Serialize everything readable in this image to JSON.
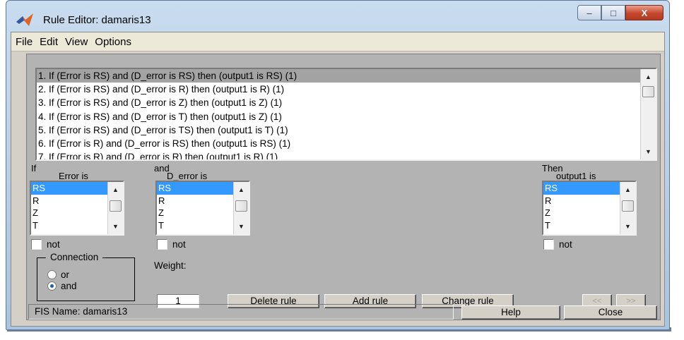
{
  "window": {
    "title": "Rule Editor: damaris13",
    "controls": [
      "–",
      "□",
      "X"
    ]
  },
  "menu": [
    "File",
    "Edit",
    "View",
    "Options"
  ],
  "rules": [
    "1. If (Error is RS) and (D_error is RS) then (output1 is RS) (1)",
    "2. If (Error is RS) and (D_error is R) then (output1 is R) (1)",
    "3. If (Error is RS) and (D_error is Z) then (output1 is Z) (1)",
    "4. If (Error is RS) and (D_error is T) then (output1 is Z) (1)",
    "5. If (Error is RS) and (D_error is TS) then (output1 is T) (1)",
    "6. If (Error is R) and (D_error is RS) then (output1 is RS) (1)",
    "7. If (Error is R) and (D_error is R) then (output1 is R) (1)"
  ],
  "inputs": {
    "error": {
      "prefix": "If",
      "label": "Error is",
      "items": [
        "RS",
        "R",
        "Z",
        "T"
      ],
      "selected": "RS",
      "not_label": "not"
    },
    "d_error": {
      "prefix": "and",
      "label": "D_error is",
      "items": [
        "RS",
        "R",
        "Z",
        "T"
      ],
      "selected": "RS",
      "not_label": "not"
    },
    "output": {
      "prefix": "Then",
      "label": "output1 is",
      "items": [
        "RS",
        "R",
        "Z",
        "T"
      ],
      "selected": "RS",
      "not_label": "not"
    }
  },
  "connection": {
    "title": "Connection",
    "options": [
      "or",
      "and"
    ],
    "selected": "and"
  },
  "weight": {
    "label": "Weight:",
    "value": "1"
  },
  "buttons": {
    "delete": "Delete rule",
    "add": "Add rule",
    "change": "Change rule",
    "prev": "<<",
    "next": ">>",
    "help": "Help",
    "close": "Close"
  },
  "status": "FIS Name: damaris13",
  "colors": {
    "selection": "#3399ff",
    "panel": "#b3b3b3"
  }
}
